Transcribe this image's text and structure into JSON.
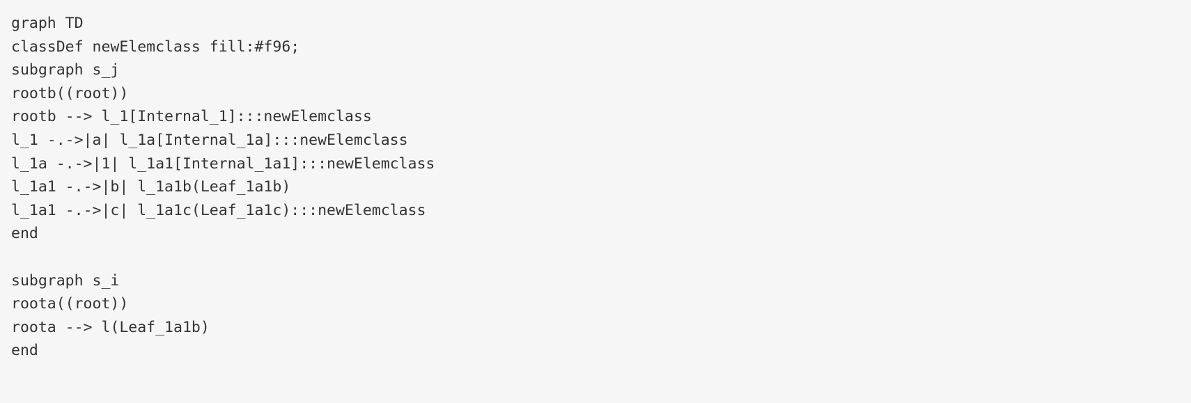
{
  "code": {
    "lines": [
      "graph TD",
      "classDef newElemclass fill:#f96;",
      "subgraph s_j",
      "rootb((root))",
      "rootb --> l_1[Internal_1]:::newElemclass",
      "l_1 -.->|a| l_1a[Internal_1a]:::newElemclass",
      "l_1a -.->|1| l_1a1[Internal_1a1]:::newElemclass",
      "l_1a1 -.->|b| l_1a1b(Leaf_1a1b)",
      "l_1a1 -.->|c| l_1a1c(Leaf_1a1c):::newElemclass",
      "end",
      "",
      "subgraph s_i",
      "roota((root))",
      "roota --> l(Leaf_1a1b)",
      "end"
    ]
  }
}
